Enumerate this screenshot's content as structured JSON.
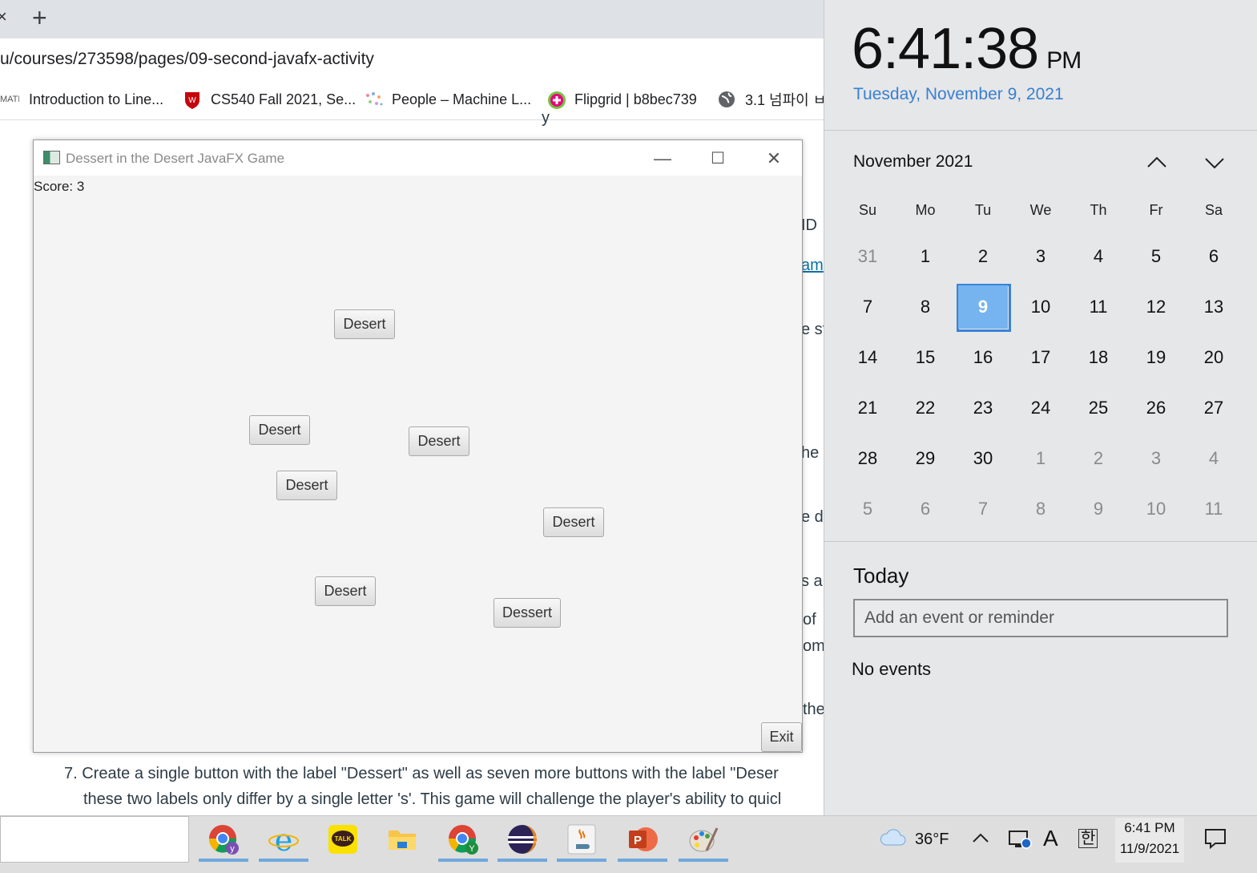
{
  "browser": {
    "tab_close": "×",
    "new_tab": "+",
    "url": "u/courses/273598/pages/09-second-javafx-activity",
    "bookmarks": [
      {
        "label": "Introduction to Line...",
        "icon": "math-icon"
      },
      {
        "label": "CS540 Fall 2021, Se...",
        "icon": "wisconsin-crest-icon"
      },
      {
        "label": "People – Machine L...",
        "icon": "people-icon"
      },
      {
        "label": "Flipgrid | b8bec739",
        "icon": "flipgrid-icon"
      },
      {
        "label": "3.1 넘파이 ㅂ",
        "icon": "globe-icon"
      }
    ]
  },
  "page": {
    "fragments": [
      "y",
      "ID",
      "am",
      "e st",
      "he",
      "e d",
      "s a",
      "of",
      "om",
      "the"
    ],
    "step7_line1": "7. Create a single button with the label \"Dessert\" as well as seven more buttons with the label \"Deser",
    "step7_line2": "these two labels only differ by a single letter 's'. This game will challenge the player's ability to quicl"
  },
  "fxwindow": {
    "title": "Dessert in the Desert JavaFX Game",
    "minimize": "—",
    "maximize": "☐",
    "close": "✕",
    "score": "Score: 3",
    "buttons": [
      "Desert",
      "Desert",
      "Desert",
      "Desert",
      "Desert",
      "Desert",
      "Dessert"
    ],
    "exit": "Exit"
  },
  "calendar": {
    "time": "6:41:38",
    "ampm": "PM",
    "full_date": "Tuesday, November 9, 2021",
    "month_label": "November 2021",
    "weekdays": [
      "Su",
      "Mo",
      "Tu",
      "We",
      "Th",
      "Fr",
      "Sa"
    ],
    "weeks": [
      [
        "31",
        "1",
        "2",
        "3",
        "4",
        "5",
        "6"
      ],
      [
        "7",
        "8",
        "9",
        "10",
        "11",
        "12",
        "13"
      ],
      [
        "14",
        "15",
        "16",
        "17",
        "18",
        "19",
        "20"
      ],
      [
        "21",
        "22",
        "23",
        "24",
        "25",
        "26",
        "27"
      ],
      [
        "28",
        "29",
        "30",
        "1",
        "2",
        "3",
        "4"
      ],
      [
        "5",
        "6",
        "7",
        "8",
        "9",
        "10",
        "11"
      ]
    ],
    "selected_day": "9",
    "today_heading": "Today",
    "event_placeholder": "Add an event or reminder",
    "no_events": "No events",
    "accent": "#3a83d8"
  },
  "taskbar": {
    "apps": [
      "chrome-profile-icon",
      "internet-explorer-icon",
      "kakaotalk-icon",
      "file-explorer-icon",
      "chrome-icon",
      "eclipse-icon",
      "java-icon",
      "powerpoint-icon",
      "paint-icon"
    ],
    "kakaotalk_label": "TALK",
    "weather": "36°F",
    "ime_letter": "A",
    "ime_korean": "한",
    "clock_time": "6:41 PM",
    "clock_date": "11/9/2021"
  }
}
